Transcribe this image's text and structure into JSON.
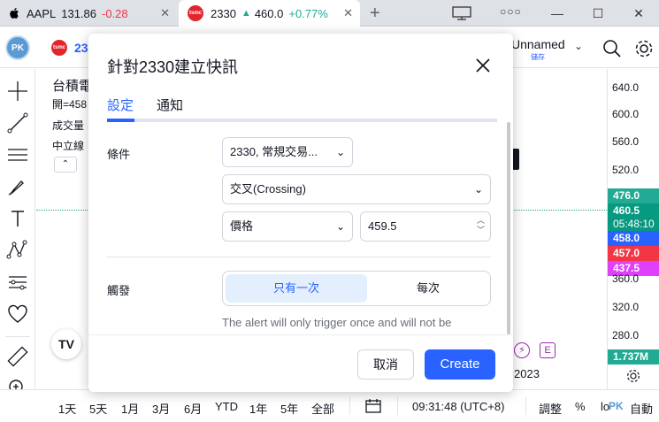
{
  "browser": {
    "tab1": {
      "symbol": "AAPL",
      "price": "131.86",
      "change": "-0.28"
    },
    "tab2": {
      "symbol": "2330",
      "arrow": "▲",
      "price": "460.0",
      "change": "+0.77%"
    },
    "close_glyph": "✕",
    "new_tab": "+",
    "win_min": "—",
    "win_max": "☐",
    "win_close": "✕",
    "dots": "○○○"
  },
  "topbar": {
    "avatar": "PK",
    "symbol_partial": "23",
    "layout_name": "Unnamed",
    "layout_sub": "儲存",
    "chevron": "⌄"
  },
  "chart": {
    "legend_title": "台積電",
    "legend_open": "開=458",
    "legend_volume": "成交量",
    "legend_neutral": "中立線",
    "collapse_glyph": "⌃",
    "tv_logo": "TV",
    "year": "2023",
    "alert_glyph": "⚡",
    "e_glyph": "E"
  },
  "price_scale": {
    "ticks": [
      "640.0",
      "600.0",
      "560.0",
      "520.0",
      "360.0",
      "320.0",
      "280.0"
    ],
    "labels": [
      {
        "value": "476.0",
        "color": "#22ab94"
      },
      {
        "value": "460.5",
        "color": "#089981"
      },
      {
        "value": "05:48:10",
        "color": "#089981"
      },
      {
        "value": "458.0",
        "color": "#2962ff"
      },
      {
        "value": "457.0",
        "color": "#f23645"
      },
      {
        "value": "437.5",
        "color": "#e040fb"
      }
    ],
    "volume": "1.737M",
    "volume_color": "#22ab94"
  },
  "bottombar": {
    "ranges": [
      "1天",
      "5天",
      "1月",
      "3月",
      "6月",
      "YTD",
      "1年",
      "5年",
      "全部"
    ],
    "time": "09:31:48 (UTC+8)",
    "adjust": "調整",
    "percent": "%",
    "log": "lo",
    "auto": "自動",
    "watermark": "PK"
  },
  "modal": {
    "title": "針對2330建立快訊",
    "tabs": [
      "設定",
      "通知"
    ],
    "condition_label": "條件",
    "condition_symbol": "2330, 常規交易...",
    "condition_operator": "交叉(Crossing)",
    "value_type": "價格",
    "value": "459.5",
    "trigger_label": "觸發",
    "trigger_once": "只有一次",
    "trigger_every": "每次",
    "note": "The alert will only trigger once and will not be",
    "cancel": "取消",
    "create": "Create"
  },
  "colors": {
    "accent": "#2962ff",
    "up": "#22ab94",
    "down": "#f23645"
  }
}
